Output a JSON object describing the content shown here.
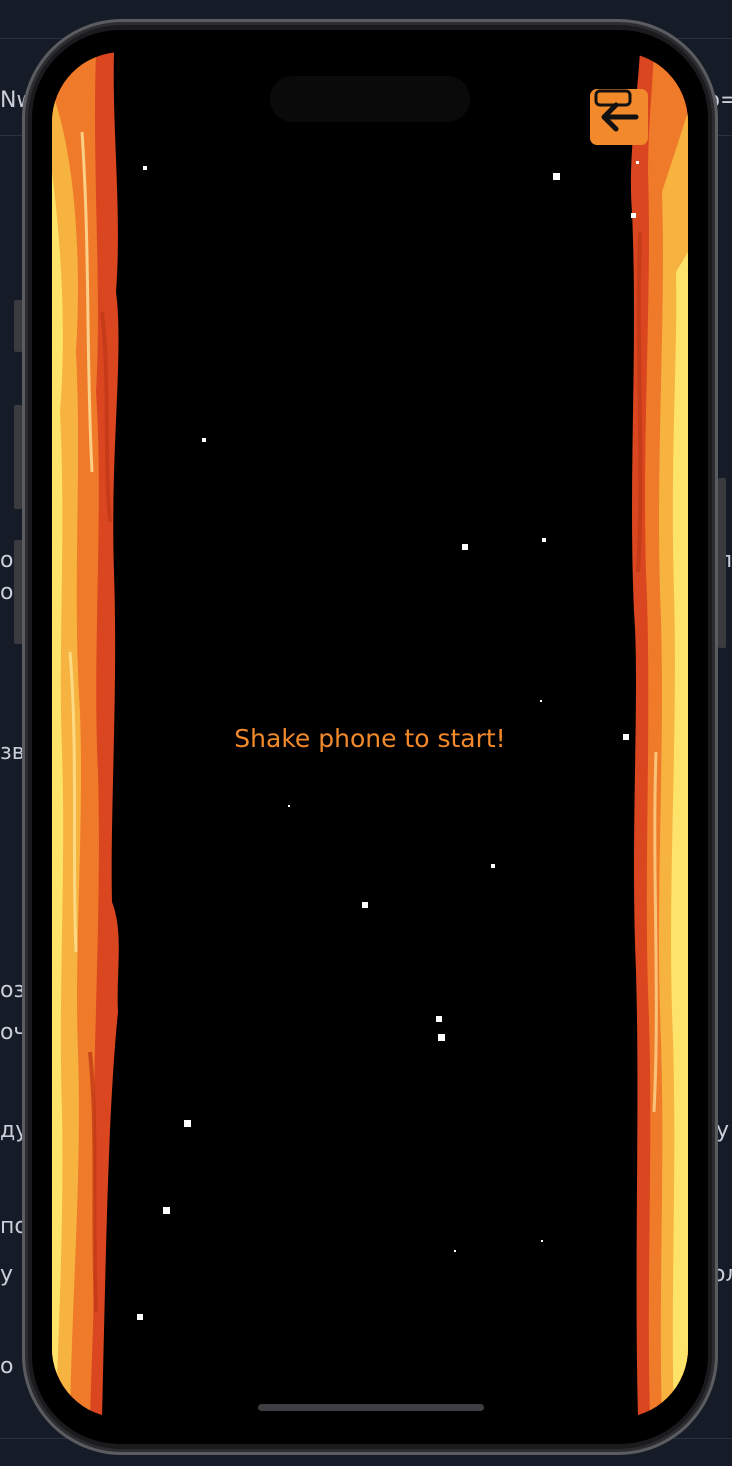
{
  "background_page": {
    "fragments": [
      "Nw",
      "p=",
      "o",
      "ов",
      "л",
      "зв",
      "оз",
      "оч",
      "ду",
      "у",
      "по",
      "у",
      "ол",
      "о"
    ]
  },
  "game": {
    "prompt": "Shake phone to start!",
    "back_button_icon": "arrow-left-icon",
    "accent_color": "#f2892b",
    "background_color": "#000000",
    "flame_colors": [
      "#d9461f",
      "#ef7a2a",
      "#f7b340",
      "#fde36a"
    ]
  }
}
